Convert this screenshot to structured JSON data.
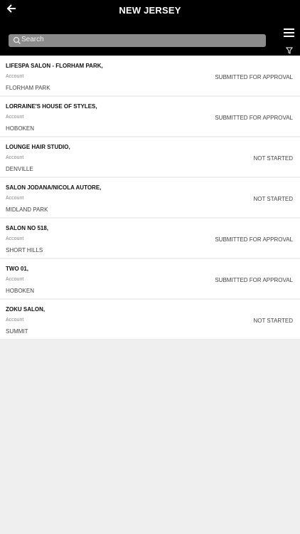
{
  "header": {
    "title": "NEW JERSEY",
    "search_placeholder": "Search"
  },
  "icons": {
    "back": "arrow-left-icon",
    "search": "search-icon",
    "menu": "hamburger-icon",
    "filter": "filter-icon"
  },
  "accounts": [
    {
      "name": "LIFESPA SALON - FLORHAM PARK,",
      "label": "Account",
      "city": "FLORHAM PARK",
      "status": "SUBMITTED FOR APPROVAL"
    },
    {
      "name": "LORRAINE'S HOUSE OF STYLES,",
      "label": "Account",
      "city": "HOBOKEN",
      "status": "SUBMITTED FOR APPROVAL"
    },
    {
      "name": "LOUNGE HAIR STUDIO,",
      "label": "Account",
      "city": "DENVILLE",
      "status": "NOT STARTED"
    },
    {
      "name": "SALON JODANA/NICOLA AUTORE,",
      "label": "Account",
      "city": "MIDLAND PARK",
      "status": "NOT STARTED"
    },
    {
      "name": "SALON NO 518,",
      "label": "Account",
      "city": "SHORT HILLS",
      "status": "SUBMITTED FOR APPROVAL"
    },
    {
      "name": "TWO 01,",
      "label": "Account",
      "city": "HOBOKEN",
      "status": "SUBMITTED FOR APPROVAL"
    },
    {
      "name": "ZOKU SALON,",
      "label": "Account",
      "city": "SUMMIT",
      "status": "NOT STARTED"
    }
  ]
}
